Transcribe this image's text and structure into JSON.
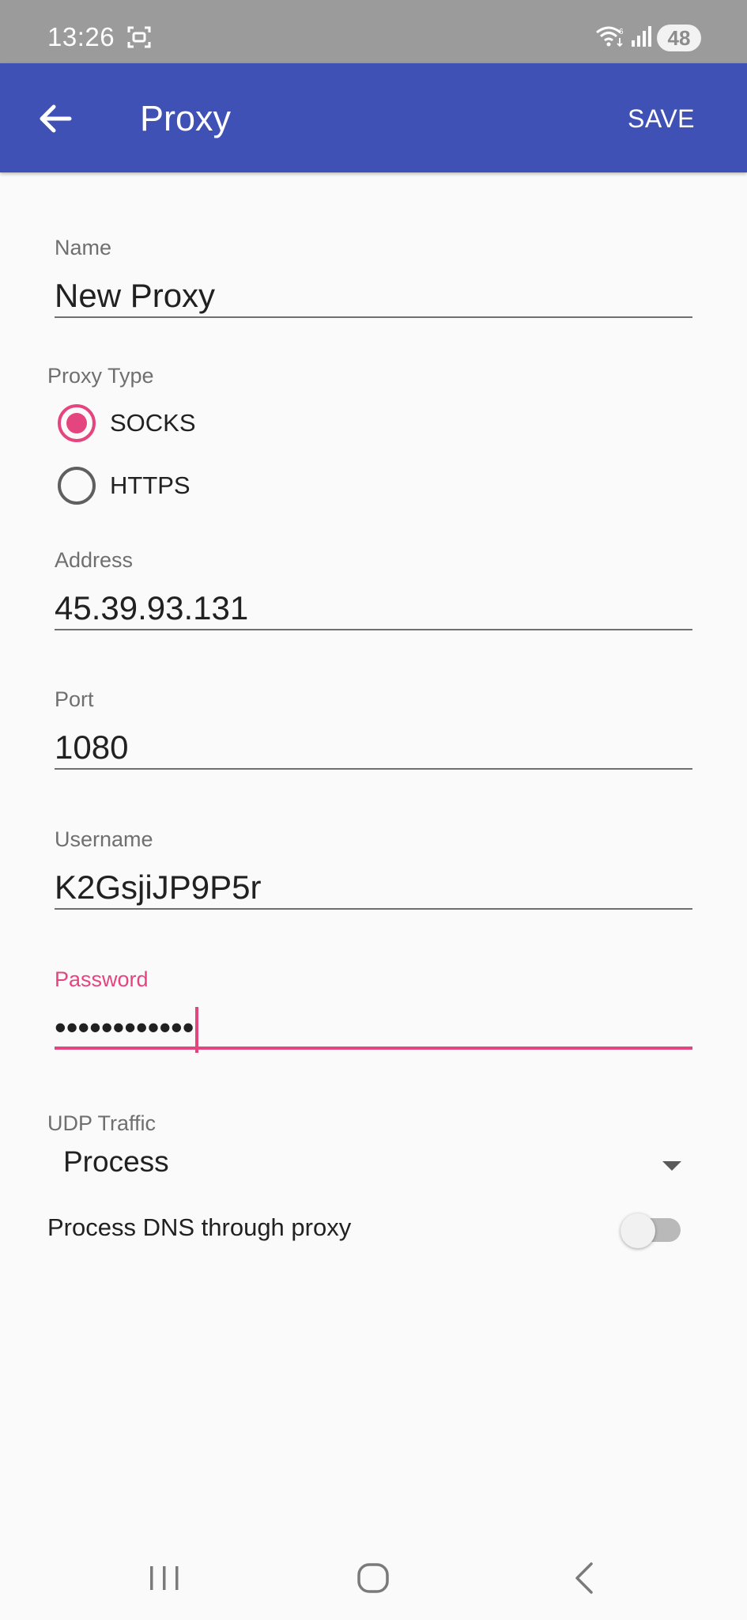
{
  "status_bar": {
    "time": "13:26",
    "battery": "48"
  },
  "app_bar": {
    "title": "Proxy",
    "save_label": "SAVE"
  },
  "form": {
    "name": {
      "label": "Name",
      "value": "New Proxy"
    },
    "proxy_type": {
      "label": "Proxy Type",
      "options": [
        {
          "label": "SOCKS",
          "checked": true
        },
        {
          "label": "HTTPS",
          "checked": false
        }
      ]
    },
    "address": {
      "label": "Address",
      "value": "45.39.93.131"
    },
    "port": {
      "label": "Port",
      "value": "1080"
    },
    "username": {
      "label": "Username",
      "value": "K2GsjiJP9P5r"
    },
    "password": {
      "label": "Password",
      "value": "••••••••••••"
    },
    "udp_traffic": {
      "label": "UDP Traffic",
      "value": "Process"
    },
    "dns_through_proxy": {
      "label": "Process DNS through proxy",
      "enabled": false
    }
  },
  "colors": {
    "app_bar": "#3f51b5",
    "accent": "#e5457e",
    "status_bar": "#9b9b9b"
  }
}
